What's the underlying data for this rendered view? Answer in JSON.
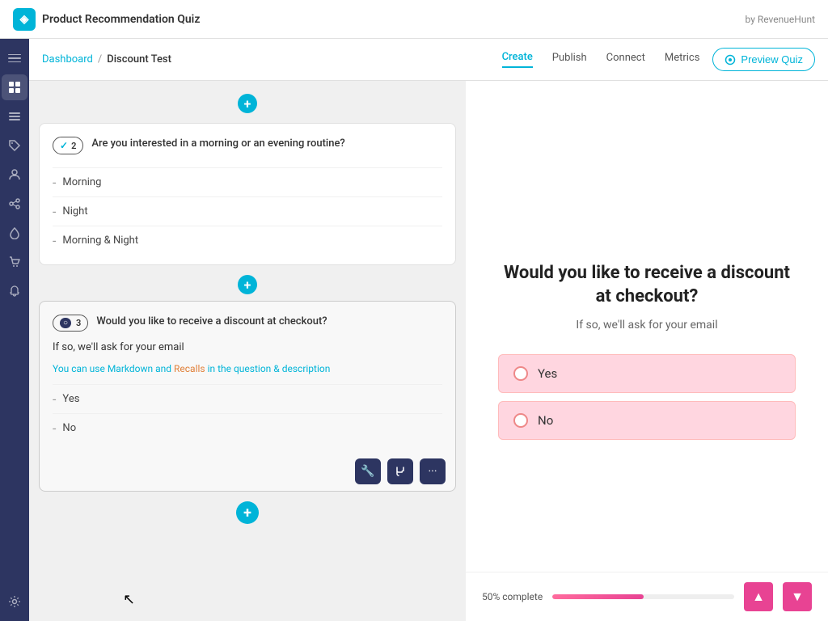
{
  "app": {
    "title": "Product Recommendation Quiz",
    "attribution": "by RevenueHunt",
    "logo_icon": "◈"
  },
  "breadcrumb": {
    "dashboard": "Dashboard",
    "separator": "/",
    "current": "Discount Test"
  },
  "nav_tabs": [
    {
      "id": "create",
      "label": "Create",
      "active": true
    },
    {
      "id": "publish",
      "label": "Publish",
      "active": false
    },
    {
      "id": "connect",
      "label": "Connect",
      "active": false
    },
    {
      "id": "metrics",
      "label": "Metrics",
      "active": false
    }
  ],
  "preview_button": {
    "label": "Preview Quiz",
    "icon": "👁"
  },
  "sidebar_icons": [
    {
      "id": "hamburger",
      "icon": "≡"
    },
    {
      "id": "grid",
      "icon": "⊞",
      "active": true
    },
    {
      "id": "list",
      "icon": "☰"
    },
    {
      "id": "tag",
      "icon": "⬡"
    },
    {
      "id": "user",
      "icon": "👤"
    },
    {
      "id": "gear2",
      "icon": "⚙"
    },
    {
      "id": "drop",
      "icon": "💧"
    },
    {
      "id": "cart",
      "icon": "🛒"
    },
    {
      "id": "bell",
      "icon": "🔔"
    },
    {
      "id": "settings",
      "icon": "⚙"
    }
  ],
  "question2": {
    "badge_number": "2",
    "question_text": "Are you interested in a morning or an evening routine?",
    "options": [
      {
        "text": "Morning"
      },
      {
        "text": "Night"
      },
      {
        "text": "Morning & Night"
      }
    ]
  },
  "question3": {
    "badge_number": "3",
    "question_text": "Would you like to receive a discount at checkout?",
    "description_text": "If so, we'll ask for your email",
    "hint_prefix": "You can use ",
    "hint_markdown": "Markdown",
    "hint_middle": " and ",
    "hint_recalls": "Recalls",
    "hint_suffix": " in the question & description",
    "options": [
      {
        "text": "Yes"
      },
      {
        "text": "No"
      }
    ]
  },
  "preview": {
    "question": "Would you like to receive a discount at checkout?",
    "description": "If so, we'll ask for your email",
    "options": [
      {
        "text": "Yes"
      },
      {
        "text": "No"
      }
    ]
  },
  "progress": {
    "label": "50% complete",
    "percent": 50
  },
  "toolbar": {
    "wrench_icon": "🔧",
    "branch_icon": "⑂",
    "more_icon": "⋯"
  },
  "add_btn_label": "+"
}
